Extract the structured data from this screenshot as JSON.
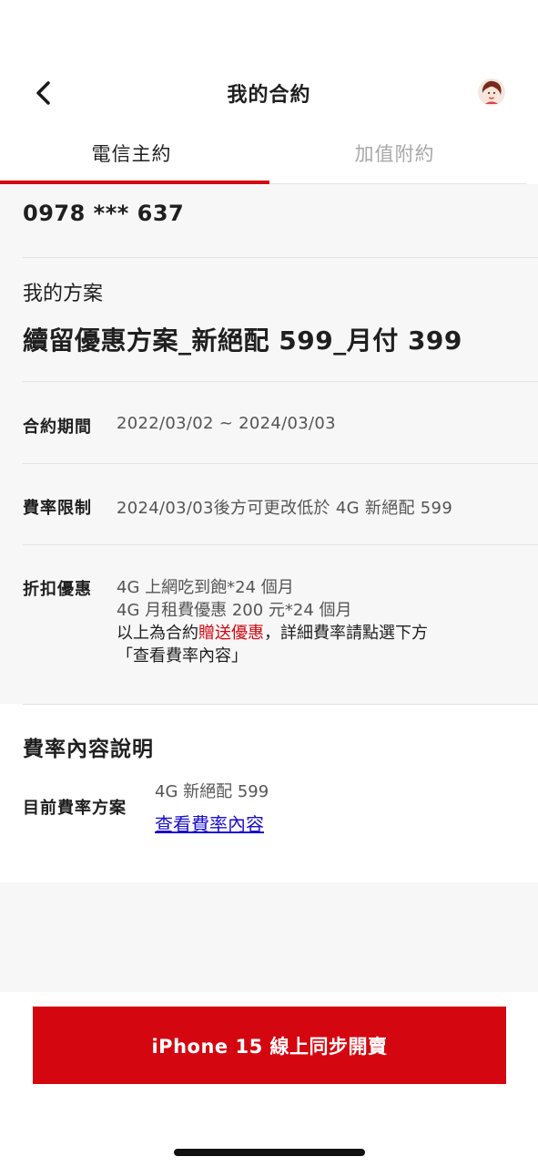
{
  "header": {
    "title": "我的合約",
    "back_icon": "chevron-left-icon",
    "avatar_icon": "user-avatar-icon"
  },
  "tabs": [
    {
      "label": "電信主約",
      "active": true
    },
    {
      "label": "加值附約",
      "active": false
    }
  ],
  "contract": {
    "phone": "0978 *** 637",
    "plan_section_label": "我的方案",
    "plan_name": "續留優惠方案_新絕配 599_月付 399",
    "period": {
      "label": "合約期間",
      "value": "2022/03/02 ~ 2024/03/03"
    },
    "rate_limit": {
      "label": "費率限制",
      "value": "2024/03/03後方可更改低於 4G 新絕配 599"
    },
    "discount": {
      "label": "折扣優惠",
      "line1": "4G 上網吃到飽*24 個月",
      "line2": "4G 月租費優惠 200 元*24 個月",
      "line3_prefix": "以上為合約",
      "line3_highlight": "贈送優惠",
      "line3_suffix": "，詳細費率請點選下方",
      "line4": "「查看費率內容」"
    }
  },
  "rate_info": {
    "title": "費率內容說明",
    "current_label": "目前費率方案",
    "current_value": "4G 新絕配 599",
    "link_text": "查看費率內容"
  },
  "cta": {
    "label": "iPhone 15 線上同步開賣"
  },
  "colors": {
    "accent": "#d40710",
    "link": "#1a0dcc",
    "text": "#1f1f1f",
    "muted": "#555555",
    "inactive_tab": "#a8a8a8"
  }
}
